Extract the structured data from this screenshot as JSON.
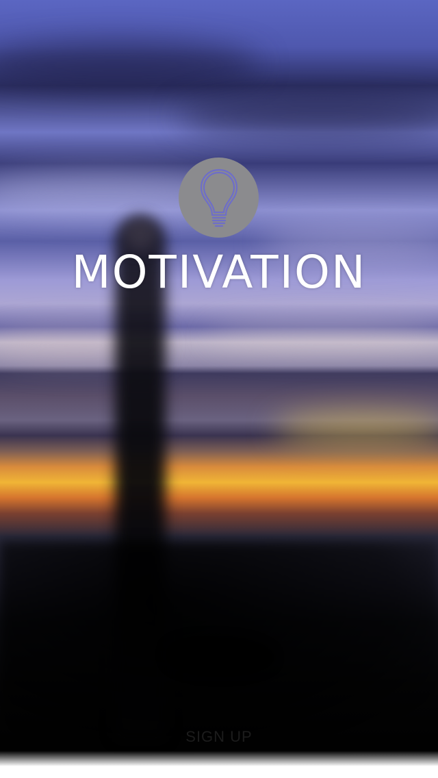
{
  "app": {
    "title": "MOTIVATION",
    "logo_icon": "lightbulb-icon",
    "logo_circle_color": "#8b8b8e",
    "logo_stroke_color": "#6e6ec8"
  },
  "actions": {
    "sign_up_label": "SIGN UP"
  }
}
